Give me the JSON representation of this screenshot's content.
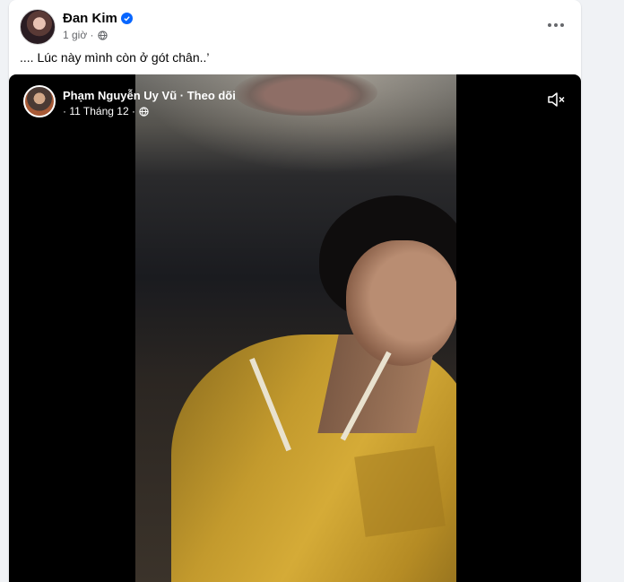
{
  "post": {
    "author": "Đan Kim",
    "time": "1 giờ ·",
    "caption": ".... Lúc này mình còn ở gót chân..’"
  },
  "video": {
    "source_name": "Phạm Nguyễn Uy Vũ",
    "follow_label": "· Theo dõi",
    "date": "· 11 Tháng 12 ·"
  },
  "icons": {
    "verified": "verified-badge-icon",
    "privacy": "globe-icon",
    "more": "more-options-icon",
    "mute": "speaker-muted-icon"
  },
  "colors": {
    "accent": "#0866ff",
    "text_primary": "#050505",
    "text_secondary": "#65676b"
  }
}
